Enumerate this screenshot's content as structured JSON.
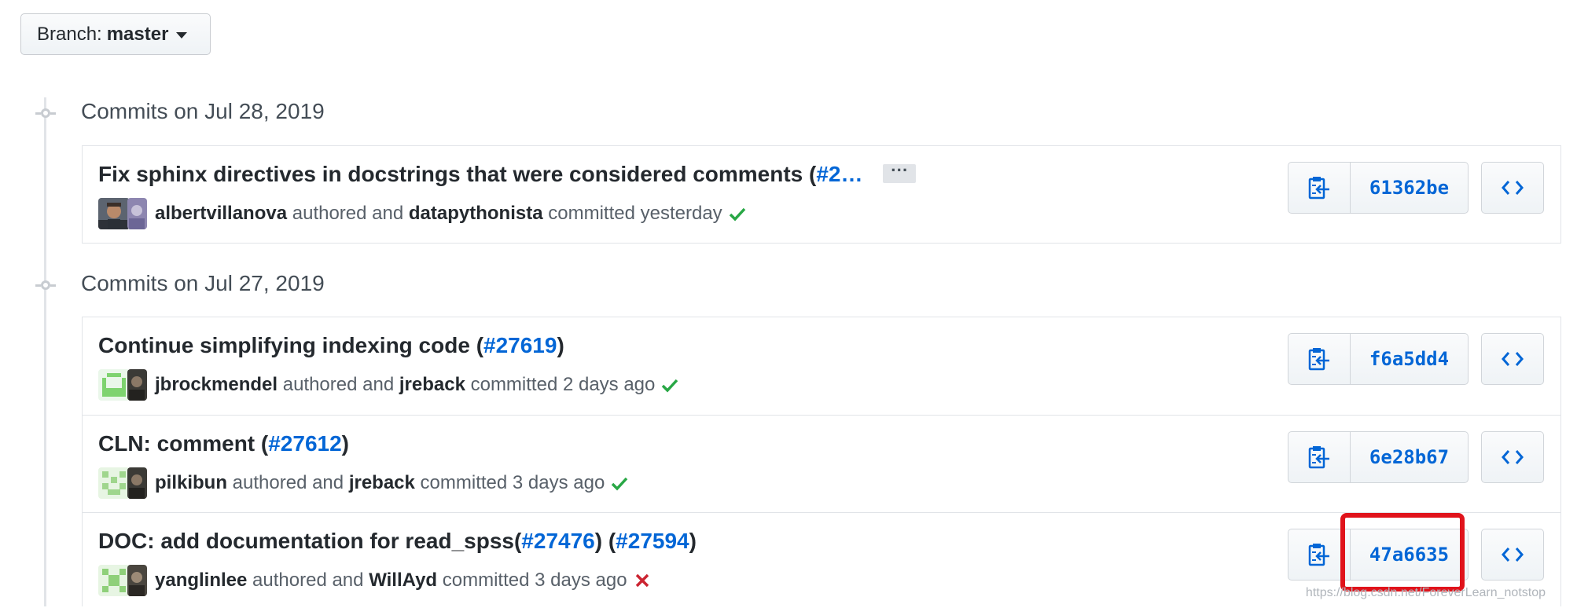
{
  "branch": {
    "label": "Branch:",
    "name": "master"
  },
  "groups": [
    {
      "title": "Commits on Jul 28, 2019",
      "commits": [
        {
          "message": "Fix sphinx directives in docstrings that were considered comments (",
          "link": "#2…",
          "suffix": "",
          "has_ellipsis": true,
          "ellipsis": "…",
          "author": "albertvillanova",
          "committer": "datapythonista",
          "authored_text": "authored and",
          "committed_text": "committed yesterday",
          "status": "success",
          "sha": "61362be"
        }
      ]
    },
    {
      "title": "Commits on Jul 27, 2019",
      "commits": [
        {
          "message": "Continue simplifying indexing code (",
          "link": "#27619",
          "suffix": ")",
          "author": "jbrockmendel",
          "committer": "jreback",
          "authored_text": "authored and",
          "committed_text": "committed 2 days ago",
          "status": "success",
          "sha": "f6a5dd4"
        },
        {
          "message": "CLN: comment (",
          "link": "#27612",
          "suffix": ")",
          "author": "pilkibun",
          "committer": "jreback",
          "authored_text": "authored and",
          "committed_text": "committed 3 days ago",
          "status": "success",
          "sha": "6e28b67"
        },
        {
          "message": "DOC: add documentation for read_spss(",
          "link": "#27476",
          "middle": ") (",
          "link2": "#27594",
          "suffix": ")",
          "author": "yanglinlee",
          "committer": "WillAyd",
          "authored_text": "authored and",
          "committed_text": "committed 3 days ago",
          "status": "failure",
          "sha": "47a6635"
        }
      ]
    }
  ],
  "icons": {
    "copy": "clipboard-icon",
    "browse": "code-icon",
    "success": "check-icon",
    "failure": "x-icon",
    "dropdown": "caret-down-icon"
  },
  "colors": {
    "link": "#0366d6",
    "success": "#28a745",
    "failure": "#cb2431",
    "highlight": "#e0131b"
  },
  "watermark": "https://blog.csdn.net/ForeverLearn_notstop"
}
